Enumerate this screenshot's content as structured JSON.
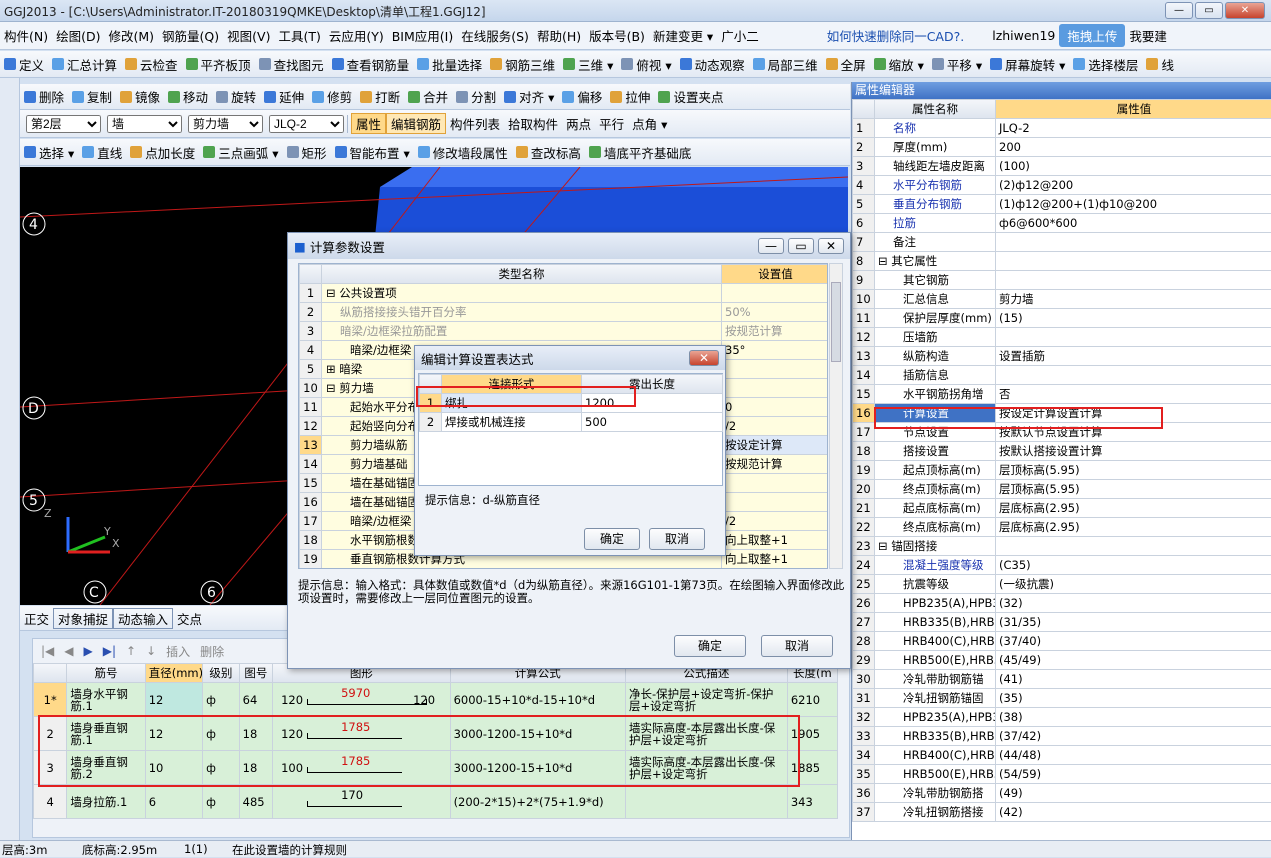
{
  "window": {
    "title": "GGJ2013 - [C:\\Users\\Administrator.IT-20180319QMKE\\Desktop\\清单\\工程1.GGJ12]"
  },
  "menu": [
    "构件(N)",
    "绘图(D)",
    "修改(M)",
    "钢筋量(Q)",
    "视图(V)",
    "工具(T)",
    "云应用(Y)",
    "BIM应用(I)",
    "在线服务(S)",
    "帮助(H)",
    "版本号(B)",
    "新建变更 ▾",
    "广小二"
  ],
  "menu_right": {
    "question": "如何快速删除同一CAD?.",
    "user": "lzhiwen19",
    "upload": "拖拽上传",
    "want": "我要建"
  },
  "toolbar1": [
    "定义",
    "汇总计算",
    "云检查",
    "平齐板顶",
    "查找图元",
    "查看钢筋量",
    "批量选择",
    "钢筋三维",
    "三维 ▾",
    "俯视 ▾",
    "动态观察",
    "局部三维",
    "全屏",
    "缩放 ▾",
    "平移 ▾",
    "屏幕旋转 ▾",
    "选择楼层",
    "线"
  ],
  "toolbar2": [
    "删除",
    "复制",
    "镜像",
    "移动",
    "旋转",
    "延伸",
    "修剪",
    "打断",
    "合并",
    "分割",
    "对齐 ▾",
    "偏移",
    "拉伸",
    "设置夹点"
  ],
  "toolbar3": {
    "floor": "第2层",
    "type": "墙",
    "subtype": "剪力墙",
    "name": "JLQ-2",
    "buttons": [
      "属性",
      "编辑钢筋",
      "构件列表",
      "拾取构件",
      "两点",
      "平行",
      "点角 ▾"
    ]
  },
  "toolbar4": [
    "选择 ▾",
    "直线",
    "点加长度",
    "三点画弧 ▾",
    "矩形",
    "智能布置 ▾",
    "修改墙段属性",
    "查改标高",
    "墙底平齐基础底"
  ],
  "axis_labels": [
    "4",
    "D",
    "5",
    "C",
    "6"
  ],
  "snap_bar": [
    "正交",
    "对象捕捉",
    "动态输入",
    "交点"
  ],
  "rebar_toolbar": [
    "插入",
    "删除"
  ],
  "rebar_table": {
    "headers": [
      "筋号",
      "直径(mm)",
      "级别",
      "图号",
      "图形",
      "计算公式",
      "公式描述",
      "长度(m"
    ],
    "rows": [
      {
        "n": "1*",
        "name": "墙身水平钢筋.1",
        "dia": "12",
        "grade": "ф",
        "fig": "64",
        "left": "120",
        "mid": "5970",
        "right": "120",
        "formula": "6000-15+10*d-15+10*d",
        "desc": "净长-保护层+设定弯折-保护层+设定弯折",
        "len": "6210"
      },
      {
        "n": "2",
        "name": "墙身垂直钢筋.1",
        "dia": "12",
        "grade": "ф",
        "fig": "18",
        "left": "120",
        "mid": "1785",
        "right": "",
        "formula": "3000-1200-15+10*d",
        "desc": "墙实际高度-本层露出长度-保护层+设定弯折",
        "len": "1905"
      },
      {
        "n": "3",
        "name": "墙身垂直钢筋.2",
        "dia": "10",
        "grade": "ф",
        "fig": "18",
        "left": "100",
        "mid": "1785",
        "right": "",
        "formula": "3000-1200-15+10*d",
        "desc": "墙实际高度-本层露出长度-保护层+设定弯折",
        "len": "1885"
      },
      {
        "n": "4",
        "name": "墙身拉筋.1",
        "dia": "6",
        "grade": "ф",
        "fig": "485",
        "left": "",
        "mid": "170",
        "right": "",
        "formula": "(200-2*15)+2*(75+1.9*d)",
        "desc": "",
        "len": "343"
      }
    ]
  },
  "prop_editor": {
    "title": "属性编辑器",
    "headers": [
      "属性名称",
      "属性值"
    ],
    "rows": [
      [
        "1",
        "名称",
        "JLQ-2",
        1
      ],
      [
        "2",
        "厚度(mm)",
        "200",
        0
      ],
      [
        "3",
        "轴线距左墙皮距离",
        "(100)",
        0
      ],
      [
        "4",
        "水平分布钢筋",
        "(2)ф12@200",
        1
      ],
      [
        "5",
        "垂直分布钢筋",
        "(1)ф12@200+(1)ф10@200",
        1
      ],
      [
        "6",
        "拉筋",
        "ф6@600*600",
        1
      ],
      [
        "7",
        "备注",
        "",
        0
      ],
      [
        "8",
        "⊟ 其它属性",
        "",
        0
      ],
      [
        "9",
        "其它钢筋",
        "",
        0
      ],
      [
        "10",
        "汇总信息",
        "剪力墙",
        0
      ],
      [
        "11",
        "保护层厚度(mm)",
        "(15)",
        0
      ],
      [
        "12",
        "压墙筋",
        "",
        0
      ],
      [
        "13",
        "纵筋构造",
        "设置插筋",
        0
      ],
      [
        "14",
        "插筋信息",
        "",
        0
      ],
      [
        "15",
        "水平钢筋拐角增",
        "否",
        0
      ],
      [
        "16",
        "计算设置",
        "按设定计算设置计算",
        0
      ],
      [
        "17",
        "节点设置",
        "按默认节点设置计算",
        0
      ],
      [
        "18",
        "搭接设置",
        "按默认搭接设置计算",
        0
      ],
      [
        "19",
        "起点顶标高(m)",
        "层顶标高(5.95)",
        0
      ],
      [
        "20",
        "终点顶标高(m)",
        "层顶标高(5.95)",
        0
      ],
      [
        "21",
        "起点底标高(m)",
        "层底标高(2.95)",
        0
      ],
      [
        "22",
        "终点底标高(m)",
        "层底标高(2.95)",
        0
      ],
      [
        "23",
        "⊟ 锚固搭接",
        "",
        0
      ],
      [
        "24",
        "混凝土强度等级",
        "(C35)",
        1
      ],
      [
        "25",
        "抗震等级",
        "(一级抗震)",
        0
      ],
      [
        "26",
        "HPB235(A),HPB3",
        "(32)",
        0
      ],
      [
        "27",
        "HRB335(B),HRB3",
        "(31/35)",
        0
      ],
      [
        "28",
        "HRB400(C),HRB4",
        "(37/40)",
        0
      ],
      [
        "29",
        "HRB500(E),HRB5",
        "(45/49)",
        0
      ],
      [
        "30",
        "冷轧带肋钢筋锚",
        "(41)",
        0
      ],
      [
        "31",
        "冷轧扭钢筋锚固",
        "(35)",
        0
      ],
      [
        "32",
        "HPB235(A),HPB3",
        "(38)",
        0
      ],
      [
        "33",
        "HRB335(B),HRB3",
        "(37/42)",
        0
      ],
      [
        "34",
        "HRB400(C),HRB4",
        "(44/48)",
        0
      ],
      [
        "35",
        "HRB500(E),HRB5",
        "(54/59)",
        0
      ],
      [
        "36",
        "冷轧带肋钢筋搭",
        "(49)",
        0
      ],
      [
        "37",
        "冷轧扭钢筋搭接",
        "(42)",
        0
      ]
    ]
  },
  "calc_dialog": {
    "title": "计算参数设置",
    "headers": [
      "类型名称",
      "设置值"
    ],
    "rows": [
      [
        "1",
        "⊟ 公共设置项",
        "",
        0
      ],
      [
        "2",
        "纵筋搭接接头错开百分率",
        "50%",
        2
      ],
      [
        "3",
        "暗梁/边框梁拉筋配置",
        "按规范计算",
        2
      ],
      [
        "4",
        "暗梁/边框梁",
        "35°",
        1
      ],
      [
        "5",
        "⊞ 暗梁",
        "",
        0
      ],
      [
        "10",
        "⊟ 剪力墙",
        "",
        0
      ],
      [
        "11",
        "起始水平分布",
        "0",
        1
      ],
      [
        "12",
        "起始竖向分布",
        "/2",
        1
      ],
      [
        "13",
        "剪力墙纵筋",
        "按设定计算",
        1
      ],
      [
        "14",
        "剪力墙基础",
        "按规范计算",
        1
      ],
      [
        "15",
        "墙在基础锚固",
        "",
        1
      ],
      [
        "16",
        "墙在基础锚固",
        "",
        1
      ],
      [
        "17",
        "暗梁/边框梁",
        "/2",
        1
      ],
      [
        "18",
        "水平钢筋根数",
        "向上取整+1",
        1
      ],
      [
        "19",
        "垂直钢筋根数计算方式",
        "向上取整+1",
        1
      ]
    ],
    "hint": "提示信息：输入格式：具体数值或数值*d（d为纵筋直径）。来源16G101-1第73页。在绘图输入界面修改此项设置时，需要修改上一层同位置图元的设置。",
    "ok": "确定",
    "cancel": "取消"
  },
  "expr_dialog": {
    "title": "编辑计算设置表达式",
    "headers": [
      "连接形式",
      "露出长度"
    ],
    "rows": [
      [
        "1",
        "绑扎",
        "1200"
      ],
      [
        "2",
        "焊接或机械连接",
        "500"
      ]
    ],
    "hint": "提示信息：d-纵筋直径",
    "ok": "确定",
    "cancel": "取消"
  },
  "status": {
    "floor_h": "层高:3m",
    "bottom": "底标高:2.95m",
    "count": "1(1)",
    "msg": "在此设置墙的计算规则"
  }
}
